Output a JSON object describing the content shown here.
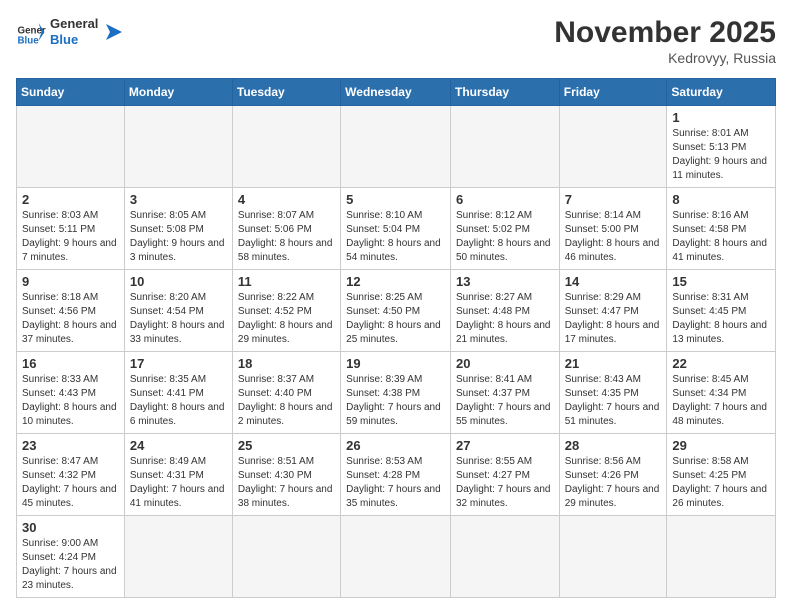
{
  "header": {
    "logo_general": "General",
    "logo_blue": "Blue",
    "month_title": "November 2025",
    "location": "Kedrovyy, Russia"
  },
  "weekdays": [
    "Sunday",
    "Monday",
    "Tuesday",
    "Wednesday",
    "Thursday",
    "Friday",
    "Saturday"
  ],
  "weeks": [
    [
      {
        "day": "",
        "info": ""
      },
      {
        "day": "",
        "info": ""
      },
      {
        "day": "",
        "info": ""
      },
      {
        "day": "",
        "info": ""
      },
      {
        "day": "",
        "info": ""
      },
      {
        "day": "",
        "info": ""
      },
      {
        "day": "1",
        "info": "Sunrise: 8:01 AM\nSunset: 5:13 PM\nDaylight: 9 hours and 11 minutes."
      }
    ],
    [
      {
        "day": "2",
        "info": "Sunrise: 8:03 AM\nSunset: 5:11 PM\nDaylight: 9 hours and 7 minutes."
      },
      {
        "day": "3",
        "info": "Sunrise: 8:05 AM\nSunset: 5:08 PM\nDaylight: 9 hours and 3 minutes."
      },
      {
        "day": "4",
        "info": "Sunrise: 8:07 AM\nSunset: 5:06 PM\nDaylight: 8 hours and 58 minutes."
      },
      {
        "day": "5",
        "info": "Sunrise: 8:10 AM\nSunset: 5:04 PM\nDaylight: 8 hours and 54 minutes."
      },
      {
        "day": "6",
        "info": "Sunrise: 8:12 AM\nSunset: 5:02 PM\nDaylight: 8 hours and 50 minutes."
      },
      {
        "day": "7",
        "info": "Sunrise: 8:14 AM\nSunset: 5:00 PM\nDaylight: 8 hours and 46 minutes."
      },
      {
        "day": "8",
        "info": "Sunrise: 8:16 AM\nSunset: 4:58 PM\nDaylight: 8 hours and 41 minutes."
      }
    ],
    [
      {
        "day": "9",
        "info": "Sunrise: 8:18 AM\nSunset: 4:56 PM\nDaylight: 8 hours and 37 minutes."
      },
      {
        "day": "10",
        "info": "Sunrise: 8:20 AM\nSunset: 4:54 PM\nDaylight: 8 hours and 33 minutes."
      },
      {
        "day": "11",
        "info": "Sunrise: 8:22 AM\nSunset: 4:52 PM\nDaylight: 8 hours and 29 minutes."
      },
      {
        "day": "12",
        "info": "Sunrise: 8:25 AM\nSunset: 4:50 PM\nDaylight: 8 hours and 25 minutes."
      },
      {
        "day": "13",
        "info": "Sunrise: 8:27 AM\nSunset: 4:48 PM\nDaylight: 8 hours and 21 minutes."
      },
      {
        "day": "14",
        "info": "Sunrise: 8:29 AM\nSunset: 4:47 PM\nDaylight: 8 hours and 17 minutes."
      },
      {
        "day": "15",
        "info": "Sunrise: 8:31 AM\nSunset: 4:45 PM\nDaylight: 8 hours and 13 minutes."
      }
    ],
    [
      {
        "day": "16",
        "info": "Sunrise: 8:33 AM\nSunset: 4:43 PM\nDaylight: 8 hours and 10 minutes."
      },
      {
        "day": "17",
        "info": "Sunrise: 8:35 AM\nSunset: 4:41 PM\nDaylight: 8 hours and 6 minutes."
      },
      {
        "day": "18",
        "info": "Sunrise: 8:37 AM\nSunset: 4:40 PM\nDaylight: 8 hours and 2 minutes."
      },
      {
        "day": "19",
        "info": "Sunrise: 8:39 AM\nSunset: 4:38 PM\nDaylight: 7 hours and 59 minutes."
      },
      {
        "day": "20",
        "info": "Sunrise: 8:41 AM\nSunset: 4:37 PM\nDaylight: 7 hours and 55 minutes."
      },
      {
        "day": "21",
        "info": "Sunrise: 8:43 AM\nSunset: 4:35 PM\nDaylight: 7 hours and 51 minutes."
      },
      {
        "day": "22",
        "info": "Sunrise: 8:45 AM\nSunset: 4:34 PM\nDaylight: 7 hours and 48 minutes."
      }
    ],
    [
      {
        "day": "23",
        "info": "Sunrise: 8:47 AM\nSunset: 4:32 PM\nDaylight: 7 hours and 45 minutes."
      },
      {
        "day": "24",
        "info": "Sunrise: 8:49 AM\nSunset: 4:31 PM\nDaylight: 7 hours and 41 minutes."
      },
      {
        "day": "25",
        "info": "Sunrise: 8:51 AM\nSunset: 4:30 PM\nDaylight: 7 hours and 38 minutes."
      },
      {
        "day": "26",
        "info": "Sunrise: 8:53 AM\nSunset: 4:28 PM\nDaylight: 7 hours and 35 minutes."
      },
      {
        "day": "27",
        "info": "Sunrise: 8:55 AM\nSunset: 4:27 PM\nDaylight: 7 hours and 32 minutes."
      },
      {
        "day": "28",
        "info": "Sunrise: 8:56 AM\nSunset: 4:26 PM\nDaylight: 7 hours and 29 minutes."
      },
      {
        "day": "29",
        "info": "Sunrise: 8:58 AM\nSunset: 4:25 PM\nDaylight: 7 hours and 26 minutes."
      }
    ],
    [
      {
        "day": "30",
        "info": "Sunrise: 9:00 AM\nSunset: 4:24 PM\nDaylight: 7 hours and 23 minutes."
      },
      {
        "day": "",
        "info": ""
      },
      {
        "day": "",
        "info": ""
      },
      {
        "day": "",
        "info": ""
      },
      {
        "day": "",
        "info": ""
      },
      {
        "day": "",
        "info": ""
      },
      {
        "day": "",
        "info": ""
      }
    ]
  ]
}
